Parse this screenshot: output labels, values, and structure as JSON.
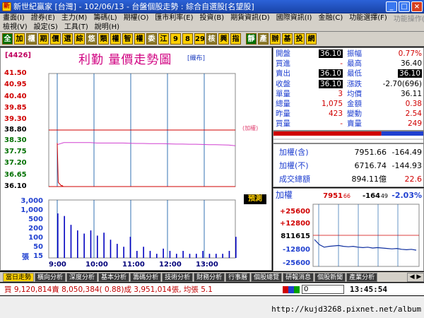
{
  "window": {
    "title": "新世紀贏家 [台灣] - 102/06/13 - 台盤個股走勢 : 綜合自選股[名望股]",
    "icon": "app-icon",
    "btn_min": "_",
    "btn_max": "□",
    "btn_close": "×"
  },
  "menu": {
    "row1": [
      "畫面(I)",
      "證券(E)",
      "主力(M)",
      "籌碼(L)",
      "期權(O)",
      "匯市利率(E)",
      "投資(B)",
      "期貨資訊(D)",
      "國際資訊(I)",
      "金融(C)",
      "功能選擇(F)"
    ],
    "row2": [
      "檢視(V)",
      "設定(S)",
      "工具(T)",
      "說明(H)"
    ],
    "right": "功能操作(F)"
  },
  "toolbar": [
    "全",
    "加",
    "櫃",
    "期",
    "價",
    "選",
    "綜",
    "悠",
    "類",
    "權",
    "智",
    "權",
    "委",
    "江",
    "9",
    "8",
    "29",
    "核",
    "興",
    "指",
    "",
    "靜",
    "產",
    "辦",
    "基",
    "投",
    "網"
  ],
  "chart": {
    "code": "[4426]",
    "title": "利勤  量價走勢圖",
    "title_link": "[織布]",
    "price_label": "(加權)",
    "predict_button": "預測",
    "price_axis": [
      "41.50",
      "40.95",
      "40.40",
      "39.85",
      "39.30",
      "38.80",
      "38.30",
      "37.75",
      "37.20",
      "36.65",
      "36.10"
    ],
    "volume_axis": [
      "3,000",
      "1,000",
      "500",
      "200",
      "100",
      "50",
      "15"
    ],
    "volume_unit": "張",
    "time_axis": [
      "9:00",
      "10:00",
      "11:00",
      "12:00",
      "13:00"
    ],
    "colors": {
      "up": "#d00000",
      "down": "#007000",
      "flat": "#000000",
      "price": "#d040d0",
      "grid": "#0050a0",
      "volume": "#0000c0"
    },
    "price_series": [
      38.18,
      36.3,
      36.25,
      36.2,
      36.14,
      36.15,
      36.1,
      36.1,
      36.1,
      36.1,
      36.1,
      36.1,
      36.1,
      36.1,
      36.1,
      36.1,
      36.1,
      36.1,
      36.1,
      36.1,
      36.1,
      36.1,
      36.1,
      36.1,
      36.1,
      36.1,
      36.1,
      36.1
    ],
    "avg_series": [
      38.1,
      38.2,
      38.2,
      38.2,
      38.2,
      38.2,
      38.18,
      38.18,
      38.18,
      38.18,
      38.18,
      38.17,
      38.16,
      38.16,
      38.15,
      38.15,
      38.15,
      38.14,
      38.13,
      38.13,
      38.12,
      38.12,
      38.11,
      38.1,
      38.1,
      38.09,
      38.08,
      38.05
    ],
    "volume_series": [
      800,
      620,
      260,
      150,
      110,
      150,
      90,
      120,
      60,
      40,
      30,
      80,
      20,
      30,
      20,
      15,
      25,
      20,
      15,
      20,
      15,
      15,
      20,
      15,
      15,
      15,
      20,
      80
    ]
  },
  "quote": {
    "rows": [
      {
        "k1": "開盤",
        "v1": "36.10",
        "k2": "振幅",
        "v2": "0.77%",
        "c1": "#000000",
        "c2": "#d00000",
        "hl1": true,
        "hl2": false
      },
      {
        "k1": "買進",
        "v1": "-",
        "k2": "最高",
        "v2": "36.40",
        "c1": "#d00000",
        "c2": "#000000",
        "hl1": false,
        "hl2": false
      },
      {
        "k1": "賣出",
        "v1": "36.10",
        "k2": "最低",
        "v2": "36.10",
        "c1": "#d00000",
        "c2": "#d00000",
        "hl1": true,
        "hl2": true
      },
      {
        "k1": "收盤",
        "v1": "36.10",
        "k2": "漲跌",
        "v2": "-2.70(696)",
        "c1": "#000000",
        "c2": "#000000",
        "hl1": true,
        "hl2": false
      },
      {
        "k1": "單量",
        "v1": "3",
        "k2": "均價",
        "v2": "36.11",
        "c1": "#d00000",
        "c2": "#000000",
        "hl1": false,
        "hl2": false
      },
      {
        "k1": "總量",
        "v1": "1,075",
        "k2": "金額",
        "v2": "0.38",
        "c1": "#d00000",
        "c2": "#d00000",
        "hl1": false,
        "hl2": false
      },
      {
        "k1": "昨量",
        "v1": "423",
        "k2": "變動",
        "v2": "2.54",
        "c1": "#d00000",
        "c2": "#d00000",
        "hl1": false,
        "hl2": false
      },
      {
        "k1": "買量",
        "v1": "-",
        "k2": "賣量",
        "v2": "249",
        "c1": "#d00000",
        "c2": "#d00000",
        "hl1": false,
        "hl2": false
      }
    ],
    "ratio_bar": {
      "red_fraction": 0.72
    }
  },
  "index": {
    "rows": [
      {
        "label": "加權(含)",
        "value": "7951.66",
        "change": "-164.49"
      },
      {
        "label": "加權(不)",
        "value": "6716.74",
        "change": "-144.93"
      },
      {
        "label": "成交總額",
        "value": "894.11億",
        "change": "22.6"
      }
    ]
  },
  "mini": {
    "title": "加權",
    "value": "7951",
    "value_dec": "66",
    "change": "-164",
    "change_dec": "49",
    "pct": "-2.03%",
    "axis": [
      "+25600",
      "+12800",
      "8116",
      "-12800",
      "-25600"
    ],
    "axis_mid_suffix": "15",
    "series": [
      0.1,
      0.22,
      0.28,
      0.26,
      0.25,
      0.24,
      0.26,
      0.27,
      0.26,
      0.28,
      0.29,
      0.28,
      0.3,
      0.29,
      0.3,
      0.31,
      0.32,
      0.31,
      0.33,
      0.34,
      0.33,
      0.35
    ]
  },
  "tabs": {
    "items": [
      "當日走勢",
      "橫向分析",
      "深度分析",
      "基本分析",
      "籌碼分析",
      "技術分析",
      "財務分析",
      "行事曆",
      "個股總覽",
      "研報消息",
      "個股新聞",
      "產業分析"
    ],
    "active": 0,
    "nav": "◀ ▶"
  },
  "status": {
    "text": "買 9,120,814賣 8,050,384( 0.88)成 3,951,014張, 均張 5.1",
    "input_value": "0",
    "time": "13:45:54"
  },
  "footer": {
    "url": "http://kujd3268.pixnet.net/album"
  }
}
